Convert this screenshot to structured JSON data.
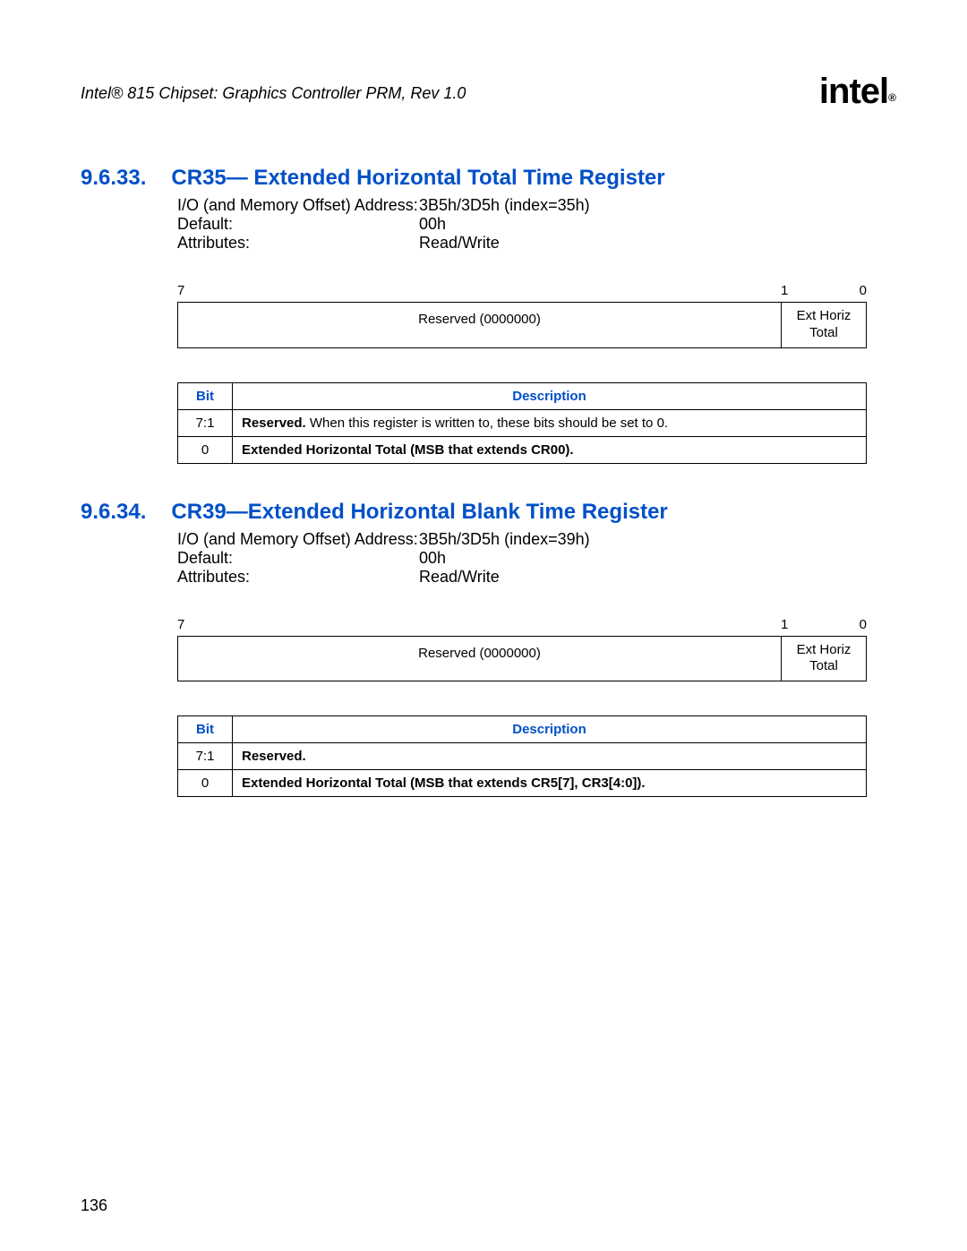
{
  "header": {
    "doc_title": "Intel® 815 Chipset: Graphics Controller PRM, Rev 1.0",
    "logo_text": "intel",
    "logo_sub": "®"
  },
  "section1": {
    "number": "9.6.33.",
    "title": "CR35— Extended Horizontal Total Time Register",
    "info": {
      "addr_label": "I/O (and Memory Offset) Address:",
      "addr_value": "3B5h/3D5h (index=35h)",
      "default_label": "Default:",
      "default_value": "00h",
      "attr_label": "Attributes:",
      "attr_value": "Read/Write"
    },
    "bitmap": {
      "left_num": "7",
      "mid_num": "1",
      "right_num": "0",
      "reserved": "Reserved (0000000)",
      "ext_l1": "Ext Horiz",
      "ext_l2": "Total"
    },
    "table": {
      "h_bit": "Bit",
      "h_desc": "Description",
      "r1_bit": "7:1",
      "r1_bold": "Reserved.",
      "r1_rest": " When this register is written to, these bits should be set to 0.",
      "r2_bit": "0",
      "r2_bold": "Extended Horizontal Total (MSB that extends CR00)."
    }
  },
  "section2": {
    "number": "9.6.34.",
    "title": "CR39—Extended Horizontal Blank Time Register",
    "info": {
      "addr_label": "I/O (and Memory Offset) Address:",
      "addr_value": "3B5h/3D5h (index=39h)",
      "default_label": "Default:",
      "default_value": "00h",
      "attr_label": "Attributes:",
      "attr_value": "Read/Write"
    },
    "bitmap": {
      "left_num": "7",
      "mid_num": "1",
      "right_num": "0",
      "reserved": "Reserved (0000000)",
      "ext_l1": "Ext Horiz",
      "ext_l2": "Total"
    },
    "table": {
      "h_bit": "Bit",
      "h_desc": "Description",
      "r1_bit": "7:1",
      "r1_bold": "Reserved.",
      "r2_bit": "0",
      "r2_bold": "Extended Horizontal Total (MSB that extends CR5[7], CR3[4:0])."
    }
  },
  "footer": {
    "page_num": "136"
  }
}
